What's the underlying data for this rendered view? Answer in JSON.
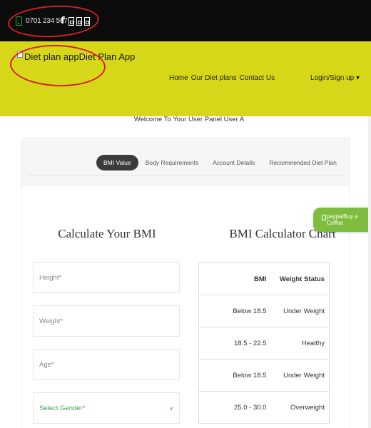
{
  "topbar": {
    "phone": "0701 234 567",
    "social_icons": [
      "facebook-icon",
      "broken-image-icon",
      "broken-image-icon",
      "broken-image-icon"
    ]
  },
  "navbar": {
    "brand": "Diet plan appDiet Plan App",
    "links": [
      "Home",
      "Our Diet plans",
      "Contact Us"
    ],
    "login": "Login/Sign up ▾"
  },
  "welcome": "Welcome To Your User Panel User A",
  "tabs": [
    {
      "label": "BMI Value",
      "active": true
    },
    {
      "label": "Body Requirements",
      "active": false
    },
    {
      "label": "Account Details",
      "active": false
    },
    {
      "label": "Recommended Diet Plan",
      "active": false
    }
  ],
  "calculator": {
    "title": "Calculate Your BMI",
    "height_placeholder": "Height*",
    "weight_placeholder": "Weight*",
    "age_placeholder": "Age*",
    "gender_placeholder": "Select Gender*"
  },
  "chart": {
    "title": "BMI Calculator Chart",
    "headers": [
      "BMI",
      "Weight Status"
    ],
    "rows": [
      [
        "Below 18.5",
        "Under Weight"
      ],
      [
        "18.5 - 22.5",
        "Healthy"
      ],
      [
        "Below 18.5",
        "Under Weight"
      ],
      [
        "25.0 - 30.0",
        "Overweight"
      ]
    ]
  },
  "coffee_button": "paypalBuy a Coffee",
  "colors": {
    "topbar": "#0c0c0c",
    "navbar": "#d7d71a",
    "accent_green": "#40a34a",
    "coffee": "#7ebd3e",
    "annotation_red": "#d32020"
  }
}
